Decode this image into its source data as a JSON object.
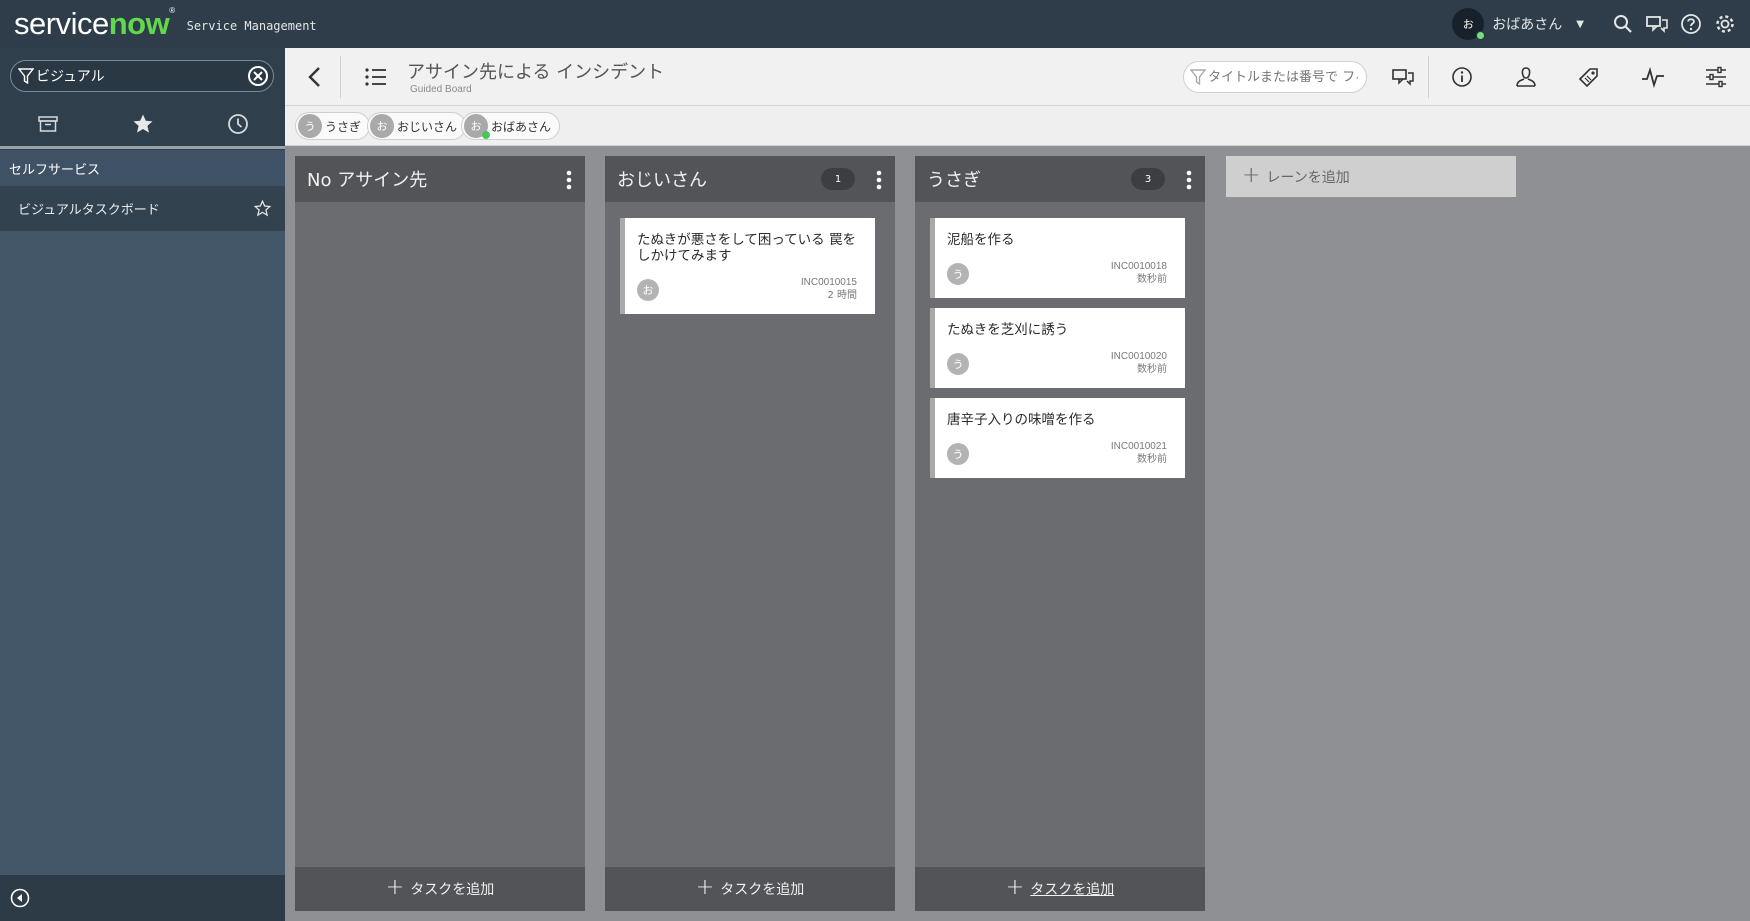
{
  "banner": {
    "logo_service": "service",
    "logo_now": "now",
    "logo_mark": "®",
    "subtitle": "Service Management",
    "user_initial": "お",
    "user_name": "おばあさん"
  },
  "nav": {
    "filter_value": "ビジュアル",
    "app_label": "セルフサービス",
    "module_label": "ビジュアルタスクボード"
  },
  "board": {
    "title": "アサイン先による インシデント",
    "subtitle": "Guided Board",
    "search_placeholder": "タイトルまたは番号で フィルター"
  },
  "filters": [
    {
      "initial": "う",
      "name": "うさぎ"
    },
    {
      "initial": "お",
      "name": "おじいさん"
    },
    {
      "initial": "お",
      "name": "おばあさん"
    }
  ],
  "lanes": [
    {
      "title": "No アサイン先",
      "count": "",
      "add_task": "タスクを追加",
      "cards": []
    },
    {
      "title": "おじいさん",
      "count": "1",
      "add_task": "タスクを追加",
      "cards": [
        {
          "title": "たぬきが悪さをして困っている 罠をしかけてみます",
          "initial": "お",
          "number": "INC0010015",
          "time": "2 時間"
        }
      ]
    },
    {
      "title": "うさぎ",
      "count": "3",
      "add_task": "タスクを追加",
      "cards": [
        {
          "title": "泥船を作る",
          "initial": "う",
          "number": "INC0010018",
          "time": "数秒前"
        },
        {
          "title": "たぬきを芝刈に誘う",
          "initial": "う",
          "number": "INC0010020",
          "time": "数秒前"
        },
        {
          "title": "唐辛子入りの味噌を作る",
          "initial": "う",
          "number": "INC0010021",
          "time": "数秒前"
        }
      ]
    }
  ],
  "add_lane_label": "レーンを追加",
  "colors": {
    "banner": "#2e3d49",
    "nav": "#445769",
    "lane": "#6b6c70",
    "lane_header": "#535458",
    "online": "#71e279"
  }
}
